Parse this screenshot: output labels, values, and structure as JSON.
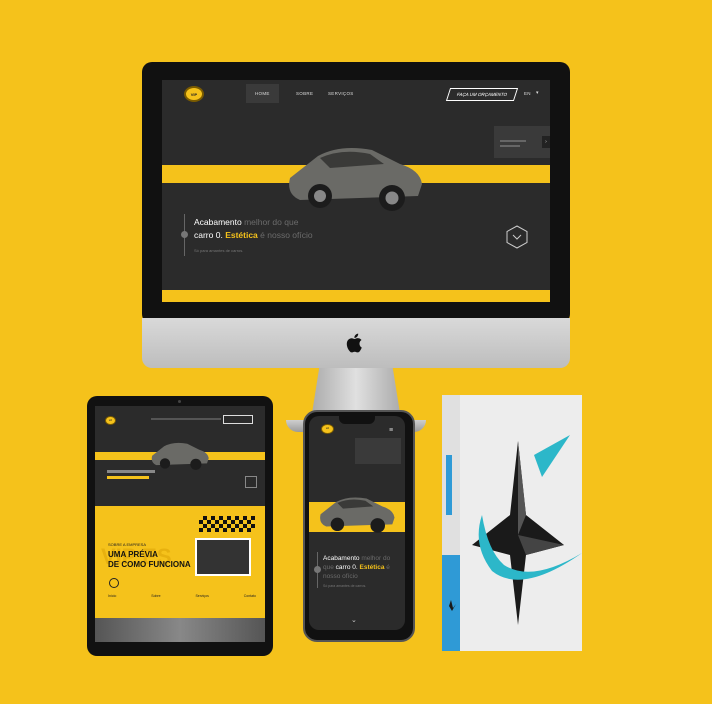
{
  "desktop": {
    "nav": {
      "home": "HOME",
      "about": "SOBRE",
      "services": "SERVIÇOS",
      "cta": "FAÇA UM ORÇAMENTO",
      "lang": "EN"
    },
    "hero": {
      "l1_white": "Acabamento ",
      "l1_dim": "melhor do que",
      "l2_white": "carro 0. ",
      "l2_yellow": "Estética",
      "l2_dim": " é nosso ofício",
      "sub": "Só para amantes de carros."
    }
  },
  "tablet": {
    "section": {
      "kicker": "SOBRE A EMPRESA",
      "h1": "UMA PRÉVIA",
      "h2": "DE COMO FUNCIONA",
      "watermark": "VIP ES"
    },
    "menu": [
      "Início",
      "Sobre",
      "Serviços",
      "Contato"
    ]
  },
  "phone": {
    "hero": {
      "l1_white": "Acabamento ",
      "l1_dim": "melhor do",
      "l2_dim": "que ",
      "l2_white": "carro 0. ",
      "l2_yellow": "Estética",
      "l2_dim2": " é",
      "l3_dim": "nosso ofício",
      "sub": "Só para amantes de carros."
    }
  },
  "colors": {
    "accent": "#f5c21b",
    "dark": "#2b2b2b",
    "book_cyan": "#2cb7c9"
  }
}
